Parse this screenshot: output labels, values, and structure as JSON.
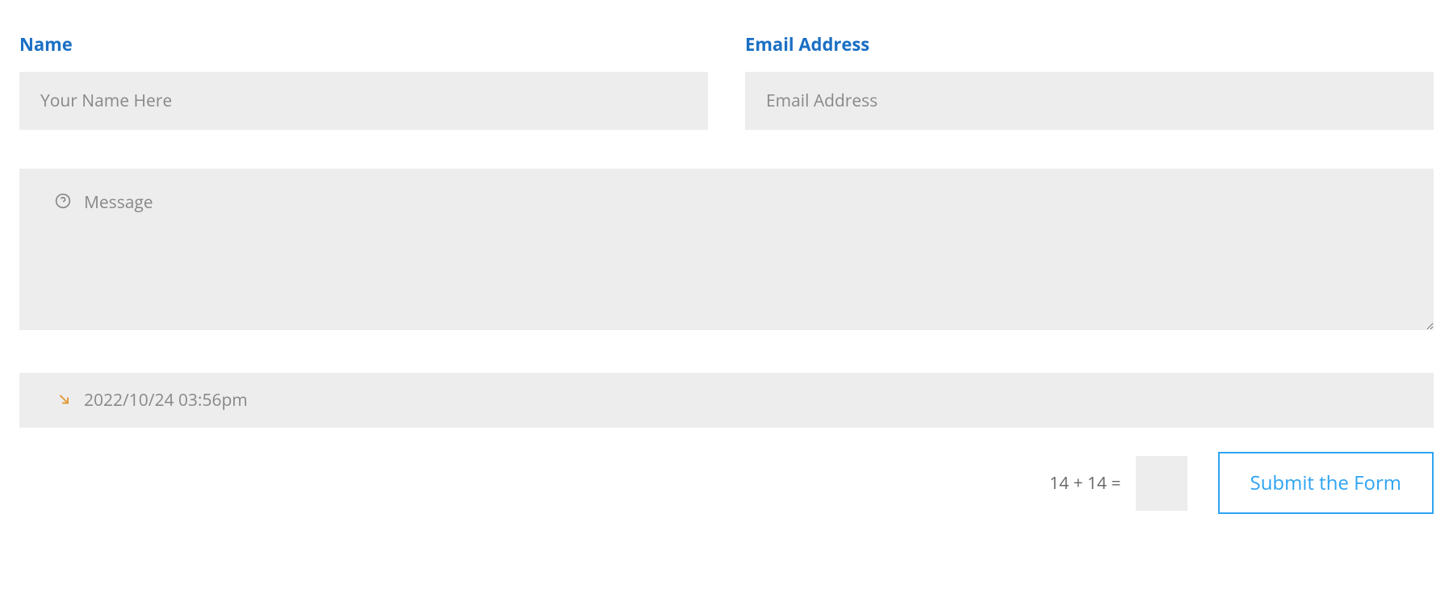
{
  "fields": {
    "name": {
      "label": "Name",
      "placeholder": "Your Name Here",
      "value": ""
    },
    "email": {
      "label": "Email Address",
      "placeholder": "Email Address",
      "value": ""
    },
    "message": {
      "placeholder": "Message",
      "value": ""
    },
    "datetime": {
      "value": "2022/10/24 03:56pm"
    }
  },
  "captcha": {
    "question": "14 + 14 =",
    "value": ""
  },
  "submit": {
    "label": "Submit the Form"
  },
  "colors": {
    "label_blue": "#1a6fc4",
    "button_blue": "#2ea3f2",
    "input_bg": "#ededed",
    "icon_orange": "#e09a3a",
    "icon_gray": "#888888"
  }
}
